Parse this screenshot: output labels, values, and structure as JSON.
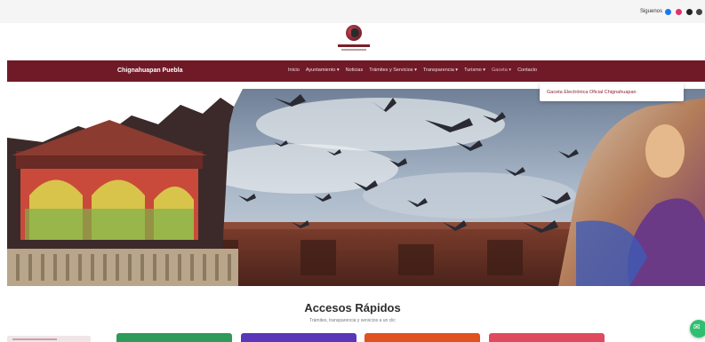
{
  "topbar": {
    "social_label": "Siguenos",
    "social_icons": [
      {
        "name": "facebook-icon",
        "color": "#1877f2"
      },
      {
        "name": "instagram-icon",
        "color": "#e1306c"
      },
      {
        "name": "youtube-icon",
        "color": "#222222"
      },
      {
        "name": "x-icon",
        "color": "#444444"
      }
    ]
  },
  "nav": {
    "brand": "Chignahuapan Puebla",
    "items": [
      {
        "label": "Inicio",
        "active": false
      },
      {
        "label": "Ayuntamiento ▾",
        "active": false
      },
      {
        "label": "Noticias",
        "active": false
      },
      {
        "label": "Trámites y Servicios ▾",
        "active": false
      },
      {
        "label": "Transparencia ▾",
        "active": false
      },
      {
        "label": "Turismo ▾",
        "active": false
      },
      {
        "label": "Gaceta ▾",
        "active": true
      },
      {
        "label": "Contacto",
        "active": false
      }
    ],
    "dropdown_item": "Gaceta Electrónica Oficial Chignahuapan"
  },
  "colors": {
    "brand": "#701a28",
    "topbar": "#f6f5f5"
  },
  "quick_access": {
    "title": "Accesos Rápidos",
    "subtitle": "Trámites, transparencia y servicios a un clic",
    "cards": [
      {
        "label": "",
        "color": "#2f9a5a"
      },
      {
        "label": "",
        "color": "#5a36b8"
      },
      {
        "label": "",
        "color": "#e0521f"
      },
      {
        "label": "",
        "color": "#e04a5e"
      }
    ]
  },
  "hero": {
    "image": "Collage of town kiosk, pigeons in flight and religious figure"
  }
}
